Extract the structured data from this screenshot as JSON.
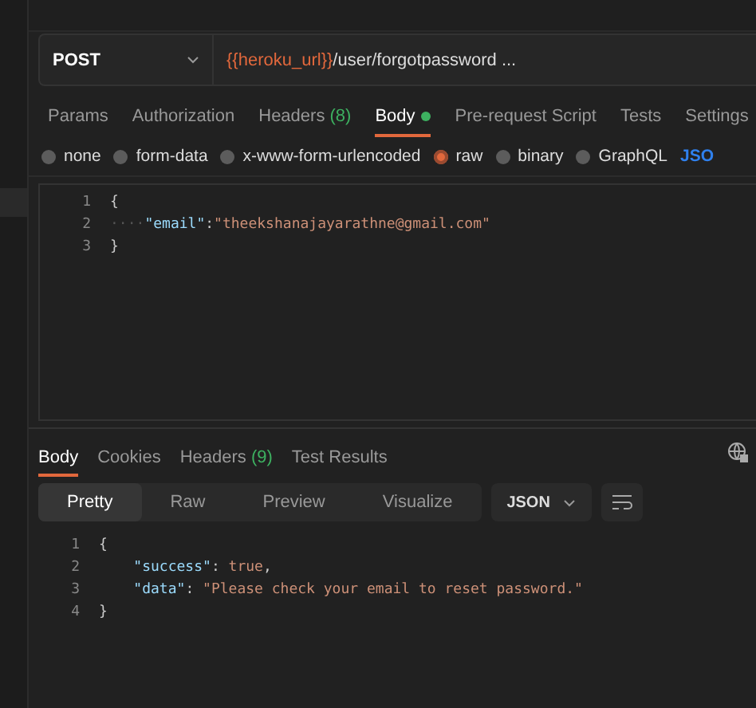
{
  "request": {
    "method": "POST",
    "url": [
      {
        "kind": "variable",
        "text": "{{heroku_url}}"
      },
      {
        "kind": "path",
        "text": "/user/forgotpassword ..."
      }
    ]
  },
  "request_tabs": [
    {
      "label": "Params",
      "dot": false,
      "selected": false
    },
    {
      "label": "Authorization",
      "dot": false,
      "selected": false
    },
    {
      "label": "Headers",
      "count": "(8)",
      "dot": false,
      "selected": false
    },
    {
      "label": "Body",
      "dot": true,
      "selected": true
    },
    {
      "label": "Pre-request Script",
      "dot": false,
      "selected": false
    },
    {
      "label": "Tests",
      "dot": false,
      "selected": false
    },
    {
      "label": "Settings",
      "dot": false,
      "selected": false
    }
  ],
  "body_types": [
    {
      "label": "none",
      "selected": false
    },
    {
      "label": "form-data",
      "selected": false
    },
    {
      "label": "x-www-form-urlencoded",
      "selected": false
    },
    {
      "label": "raw",
      "selected": true
    },
    {
      "label": "binary",
      "selected": false
    },
    {
      "label": "GraphQL",
      "selected": false
    }
  ],
  "raw_format": "JSO",
  "request_body": [
    {
      "number": "1",
      "tokens": [
        {
          "kind": "brace",
          "text": "{"
        }
      ]
    },
    {
      "number": "2",
      "tokens": [
        {
          "kind": "indent",
          "text": "····"
        },
        {
          "kind": "key",
          "text": "\"email\""
        },
        {
          "kind": "punct",
          "text": ":"
        },
        {
          "kind": "string",
          "text": "\"theekshanajayarathne@gmail.com\""
        }
      ]
    },
    {
      "number": "3",
      "tokens": [
        {
          "kind": "brace",
          "text": "}"
        }
      ]
    }
  ],
  "response_tabs": [
    {
      "label": "Body",
      "selected": true
    },
    {
      "label": "Cookies",
      "selected": false
    },
    {
      "label": "Headers",
      "count": "(9)",
      "selected": false
    },
    {
      "label": "Test Results",
      "selected": false
    }
  ],
  "view_modes": [
    {
      "label": "Pretty",
      "selected": true
    },
    {
      "label": "Raw",
      "selected": false
    },
    {
      "label": "Preview",
      "selected": false
    },
    {
      "label": "Visualize",
      "selected": false
    }
  ],
  "response_format": "JSON",
  "response_body": [
    {
      "number": "1",
      "tokens": [
        {
          "kind": "brace",
          "text": "{"
        }
      ]
    },
    {
      "number": "2",
      "indented": true,
      "tokens": [
        {
          "kind": "key",
          "text": "\"success\""
        },
        {
          "kind": "punct",
          "text": ": "
        },
        {
          "kind": "literal",
          "text": "true"
        },
        {
          "kind": "punct",
          "text": ","
        }
      ]
    },
    {
      "number": "3",
      "indented": true,
      "tokens": [
        {
          "kind": "key",
          "text": "\"data\""
        },
        {
          "kind": "punct",
          "text": ": "
        },
        {
          "kind": "string",
          "text": "\"Please check your email to reset password.\""
        }
      ]
    },
    {
      "number": "4",
      "tokens": [
        {
          "kind": "brace",
          "text": "}"
        }
      ]
    }
  ]
}
